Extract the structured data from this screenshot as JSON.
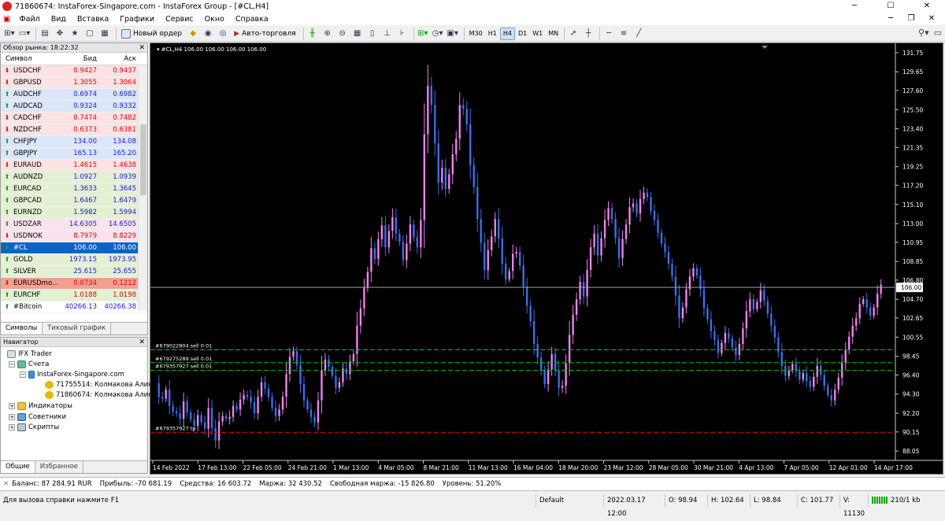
{
  "window": {
    "title": "71860674: InstaForex-Singapore.com - InstaForex Group - [#CL,H4]",
    "minimize": "─",
    "maximize": "☐",
    "close": "✕"
  },
  "menu": {
    "items": [
      "Файл",
      "Вид",
      "Вставка",
      "Графики",
      "Сервис",
      "Окно",
      "Справка"
    ],
    "child_controls": [
      "─",
      "❐",
      "✕"
    ]
  },
  "toolbar": {
    "new_order": "Новый ордер",
    "auto_trading": "Авто-торговля",
    "timeframes": [
      "M30",
      "H1",
      "H4",
      "D1",
      "W1",
      "MN"
    ],
    "active_timeframe": "H4"
  },
  "market_watch": {
    "title": "Обзор рынка: 18:22:32",
    "col_symbol": "Символ",
    "col_bid": "Бид",
    "col_ask": "Аск",
    "rows": [
      {
        "symbol": "USDCHF",
        "bid": "0.9427",
        "ask": "0.9437",
        "bg": "#fbe3e3",
        "color": "#e0000a",
        "dir": "down"
      },
      {
        "symbol": "GBPUSD",
        "bid": "1.3055",
        "ask": "1.3064",
        "bg": "#fbe3e3",
        "color": "#e0000a",
        "dir": "down"
      },
      {
        "symbol": "AUDCHF",
        "bid": "0.6974",
        "ask": "0.6982",
        "bg": "#dce6fa",
        "color": "#1a1ad8",
        "dir": "up"
      },
      {
        "symbol": "AUDCAD",
        "bid": "0.9324",
        "ask": "0.9332",
        "bg": "#dce6fa",
        "color": "#1a1ad8",
        "dir": "up"
      },
      {
        "symbol": "CADCHF",
        "bid": "0.7474",
        "ask": "0.7482",
        "bg": "#fbe3e3",
        "color": "#e0000a",
        "dir": "down"
      },
      {
        "symbol": "NZDCHF",
        "bid": "0.6373",
        "ask": "0.6381",
        "bg": "#fbe3e3",
        "color": "#e0000a",
        "dir": "down"
      },
      {
        "symbol": "CHFJPY",
        "bid": "134.00",
        "ask": "134.08",
        "bg": "#dce6fa",
        "color": "#1a1ad8",
        "dir": "up"
      },
      {
        "symbol": "GBPJPY",
        "bid": "165.13",
        "ask": "165.20",
        "bg": "#dce6fa",
        "color": "#1a1ad8",
        "dir": "up"
      },
      {
        "symbol": "EURAUD",
        "bid": "1.4615",
        "ask": "1.4638",
        "bg": "#fbe3e3",
        "color": "#e0000a",
        "dir": "down"
      },
      {
        "symbol": "AUDNZD",
        "bid": "1.0927",
        "ask": "1.0939",
        "bg": "#e3f0d2",
        "color": "#1a1ad8",
        "dir": "up"
      },
      {
        "symbol": "EURCAD",
        "bid": "1.3633",
        "ask": "1.3645",
        "bg": "#e3f0d2",
        "color": "#1a1ad8",
        "dir": "up"
      },
      {
        "symbol": "GBPCAD",
        "bid": "1.6467",
        "ask": "1.6479",
        "bg": "#e3f0d2",
        "color": "#1a1ad8",
        "dir": "up"
      },
      {
        "symbol": "EURNZD",
        "bid": "1.5982",
        "ask": "1.5994",
        "bg": "#e3f0d2",
        "color": "#1a1ad8",
        "dir": "up"
      },
      {
        "symbol": "USDZAR",
        "bid": "14.6305",
        "ask": "14.6505",
        "bg": "#fbe3ee",
        "color": "#1a1ad8",
        "dir": "up"
      },
      {
        "symbol": "USDNOK",
        "bid": "8.7979",
        "ask": "8.8229",
        "bg": "#fbe3ee",
        "color": "#e0000a",
        "dir": "down"
      },
      {
        "symbol": "#CL",
        "bid": "106.00",
        "ask": "106.00",
        "bg": "#0a64c8",
        "color": "#ffffff",
        "dir": "up"
      },
      {
        "symbol": "GOLD",
        "bid": "1973.15",
        "ask": "1973.95",
        "bg": "#e3f0d2",
        "color": "#1a1ad8",
        "dir": "up"
      },
      {
        "symbol": "SILVER",
        "bid": "25.615",
        "ask": "25.655",
        "bg": "#e3f0d2",
        "color": "#1a1ad8",
        "dir": "up"
      },
      {
        "symbol": "EURUSDmo...",
        "bid": "0.0734",
        "ask": "0.1212",
        "bg": "#f4a08e",
        "color": "#e0000a",
        "dir": "down"
      },
      {
        "symbol": "EURCHF",
        "bid": "1.0188",
        "ask": "1.0198",
        "bg": "#e3f0d2",
        "color": "#e0000a",
        "dir": "up"
      },
      {
        "symbol": "#Bitcoin",
        "bid": "40266.13",
        "ask": "40266.38",
        "bg": "#ffffff",
        "color": "#1a1ad8",
        "dir": "up"
      }
    ],
    "tabs": [
      "Символы",
      "Тиковый график"
    ]
  },
  "navigator": {
    "title": "Навигатор",
    "root": "IFX Trader",
    "accounts": "Счета",
    "server": "InstaForex-Singapore.com",
    "account_1": "71755514: Колмакова Алина",
    "account_2": "71860674: Колмакова Алина",
    "indicators": "Индикаторы",
    "advisors": "Советники",
    "scripts": "Скрипты",
    "tabs": [
      "Общие",
      "Избранное"
    ]
  },
  "chart_data": {
    "type": "candlestick",
    "header": "#CL,H4  106.00 106.00 106.00 106.00",
    "x_tick_labels": [
      "14 Feb 2022",
      "17 Feb 13:00",
      "22 Feb 05:00",
      "24 Feb 21:00",
      "1 Mar 13:00",
      "4 Mar 05:00",
      "8 Mar 21:00",
      "11 Mar 13:00",
      "16 Mar 04:00",
      "18 Mar 20:00",
      "23 Mar 12:00",
      "28 Mar 05:00",
      "30 Mar 21:00",
      "4 Apr 13:00",
      "7 Apr 05:00",
      "12 Apr 01:00",
      "14 Apr 17:00"
    ],
    "y_tick_labels": [
      "131.75",
      "129.65",
      "127.60",
      "125.50",
      "123.40",
      "121.35",
      "119.25",
      "117.20",
      "115.10",
      "113.00",
      "110.95",
      "108.85",
      "106.80",
      "104.70",
      "102.65",
      "100.55",
      "98.45",
      "96.40",
      "94.30",
      "92.20",
      "90.15",
      "88.05"
    ],
    "ylim": [
      87.2,
      132.6
    ],
    "current_price": 106.0,
    "current_price_label": "106.00",
    "orders": [
      {
        "label": "#679022804 sell 0.01",
        "price": 99.15,
        "color": "#00c800"
      },
      {
        "label": "#679275289 sell 0.01",
        "price": 97.75,
        "color": "#00c800"
      },
      {
        "label": "#679357927 sell 0.01",
        "price": 96.9,
        "color": "#00c800"
      },
      {
        "label": "#679357927 tp",
        "price": 90.1,
        "color": "#e00000"
      }
    ],
    "bull_color": "#ee82ee",
    "bear_color": "#3c6ee6",
    "path": [
      95.5,
      94.0,
      93.8,
      94.8,
      93.0,
      92.4,
      92.2,
      91.6,
      93.5,
      92.3,
      91.5,
      90.8,
      92.0,
      91.2,
      90.5,
      92.8,
      90.6,
      89.2,
      91.3,
      91.9,
      91.6,
      91.8,
      93.0,
      92.6,
      93.7,
      94.2,
      94.0,
      93.4,
      92.2,
      94.0,
      95.6,
      94.9,
      94.0,
      92.8,
      91.9,
      92.6,
      94.0,
      96.5,
      98.4,
      99.0,
      97.5,
      95.4,
      93.6,
      92.6,
      91.8,
      91.2,
      93.6,
      96.9,
      98.1,
      97.3,
      96.3,
      95.0,
      95.6,
      97.1,
      96.5,
      97.9,
      98.7,
      101.8,
      103.7,
      106.0,
      107.7,
      110.3,
      109.1,
      111.3,
      112.8,
      110.4,
      112.2,
      113.7,
      111.9,
      111.0,
      109.0,
      110.8,
      112.9,
      111.5,
      110.4,
      113.4,
      122.8,
      128.1,
      126.0,
      121.8,
      117.5,
      119.1,
      116.8,
      118.4,
      120.6,
      122.3,
      126.0,
      125.6,
      123.9,
      119.4,
      117.0,
      113.5,
      110.9,
      107.9,
      110.1,
      111.6,
      113.5,
      111.4,
      108.6,
      106.9,
      107.8,
      109.7,
      109.9,
      108.4,
      106.1,
      104.0,
      102.3,
      99.8,
      98.3,
      96.9,
      95.4,
      97.0,
      98.7,
      96.9,
      95.0,
      95.2,
      97.7,
      100.8,
      103.0,
      104.7,
      106.6,
      105.0,
      107.9,
      110.4,
      111.9,
      109.5,
      111.4,
      113.4,
      114.7,
      113.5,
      111.4,
      109.2,
      111.3,
      112.9,
      114.8,
      115.2,
      114.1,
      115.7,
      116.4,
      115.9,
      114.4,
      113.4,
      112.0,
      110.8,
      109.9,
      108.6,
      107.2,
      105.1,
      102.6,
      103.8,
      105.8,
      107.2,
      108.1,
      107.3,
      105.8,
      103.7,
      102.5,
      101.2,
      100.2,
      98.8,
      99.9,
      101.0,
      100.4,
      99.4,
      98.6,
      99.8,
      101.5,
      103.4,
      104.7,
      103.6,
      104.4,
      105.7,
      104.5,
      103.1,
      101.8,
      100.5,
      98.9,
      97.4,
      96.3,
      96.9,
      97.6,
      96.8,
      95.9,
      96.6,
      95.7,
      95.1,
      96.2,
      97.4,
      96.4,
      95.2,
      94.2,
      93.6,
      94.8,
      96.1,
      97.7,
      99.2,
      100.6,
      101.8,
      102.6,
      104.2,
      104.7,
      103.8,
      102.9,
      103.8,
      105.3,
      106.3
    ]
  },
  "terminal": {
    "balance": "Баланс: 87 284.91 RUR",
    "profit": "Прибыль: -70 681.19",
    "equity": "Средства: 16 603.72",
    "margin": "Маржа: 32 430.52",
    "free_margin": "Свободная маржа: -15 826.80",
    "level": "Уровень: 51.20%"
  },
  "status": {
    "help": "Для вызова справки нажмите F1",
    "profile": "Default",
    "datetime": "2022.03.17 12:00",
    "open": "O: 98.94",
    "high": "H: 102.64",
    "low": "L: 98.84",
    "close": "C: 101.77",
    "volume": "V: 11130",
    "traffic": "210/1 kb"
  }
}
